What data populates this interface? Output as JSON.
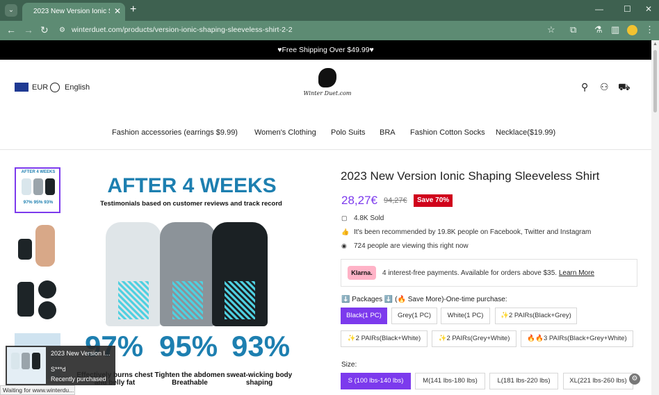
{
  "browser": {
    "tab_title": "2023 New Version Ionic Shapi",
    "url": "winterduet.com/products/version-ionic-shaping-sleeveless-shirt-2-2"
  },
  "announcement": "♥Free Shipping Over $49.99♥",
  "header": {
    "currency": "EUR",
    "language": "English",
    "logo_text": "Winter Duet.com"
  },
  "nav": [
    "Fashion accessories  (earrings $9.99)",
    "Women's Clothing",
    "Polo Suits",
    "BRA",
    "Fashion Cotton Socks",
    "Necklace($19.99)"
  ],
  "gallery": {
    "headline": "AFTER 4 WEEKS",
    "subhead": "Testimonials based on customer reviews and track record",
    "stats": [
      {
        "value": "97%",
        "caption": "Effectively burns chest and belly fat"
      },
      {
        "value": "95%",
        "caption": "Tighten the abdomen Breathable"
      },
      {
        "value": "93%",
        "caption": "sweat-wicking body shaping"
      }
    ]
  },
  "product": {
    "title": "2023 New Version Ionic Shaping Sleeveless Shirt",
    "price": "28,27€",
    "old_price": "94,27€",
    "save": "Save 70%",
    "sold": "4.8K Sold",
    "recommend": "It's been recommended by 19.8K people on Facebook, Twitter and Instagram",
    "viewing": "724 people are viewing this right now",
    "klarna_logo": "Klarna.",
    "klarna_text": "4 interest-free payments. Available for orders above $35.",
    "klarna_link": "Learn More",
    "packages_label": "⬇️ Packages ⬇️ (🔥 Save More)-One-time purchase:",
    "packages": [
      "Black(1 PC)",
      "Grey(1 PC)",
      "White(1 PC)",
      "✨2 PAIRs(Black+Grey)",
      "✨2 PAIRs(Black+White)",
      "✨2 PAIRs(Grey+White)",
      "🔥🔥3 PAIRs(Black+Grey+White)"
    ],
    "size_label": "Size:",
    "sizes": [
      "S (100 lbs-140 lbs)",
      "M(141 lbs-180 lbs)",
      "L(181 lbs-220 lbs)",
      "XL(221 lbs-260 lbs)"
    ]
  },
  "popup": {
    "title": "2023 New Version I...",
    "name": "S***d",
    "sub": "Recently purchased"
  },
  "status": "Waiting for www.winterdu..."
}
